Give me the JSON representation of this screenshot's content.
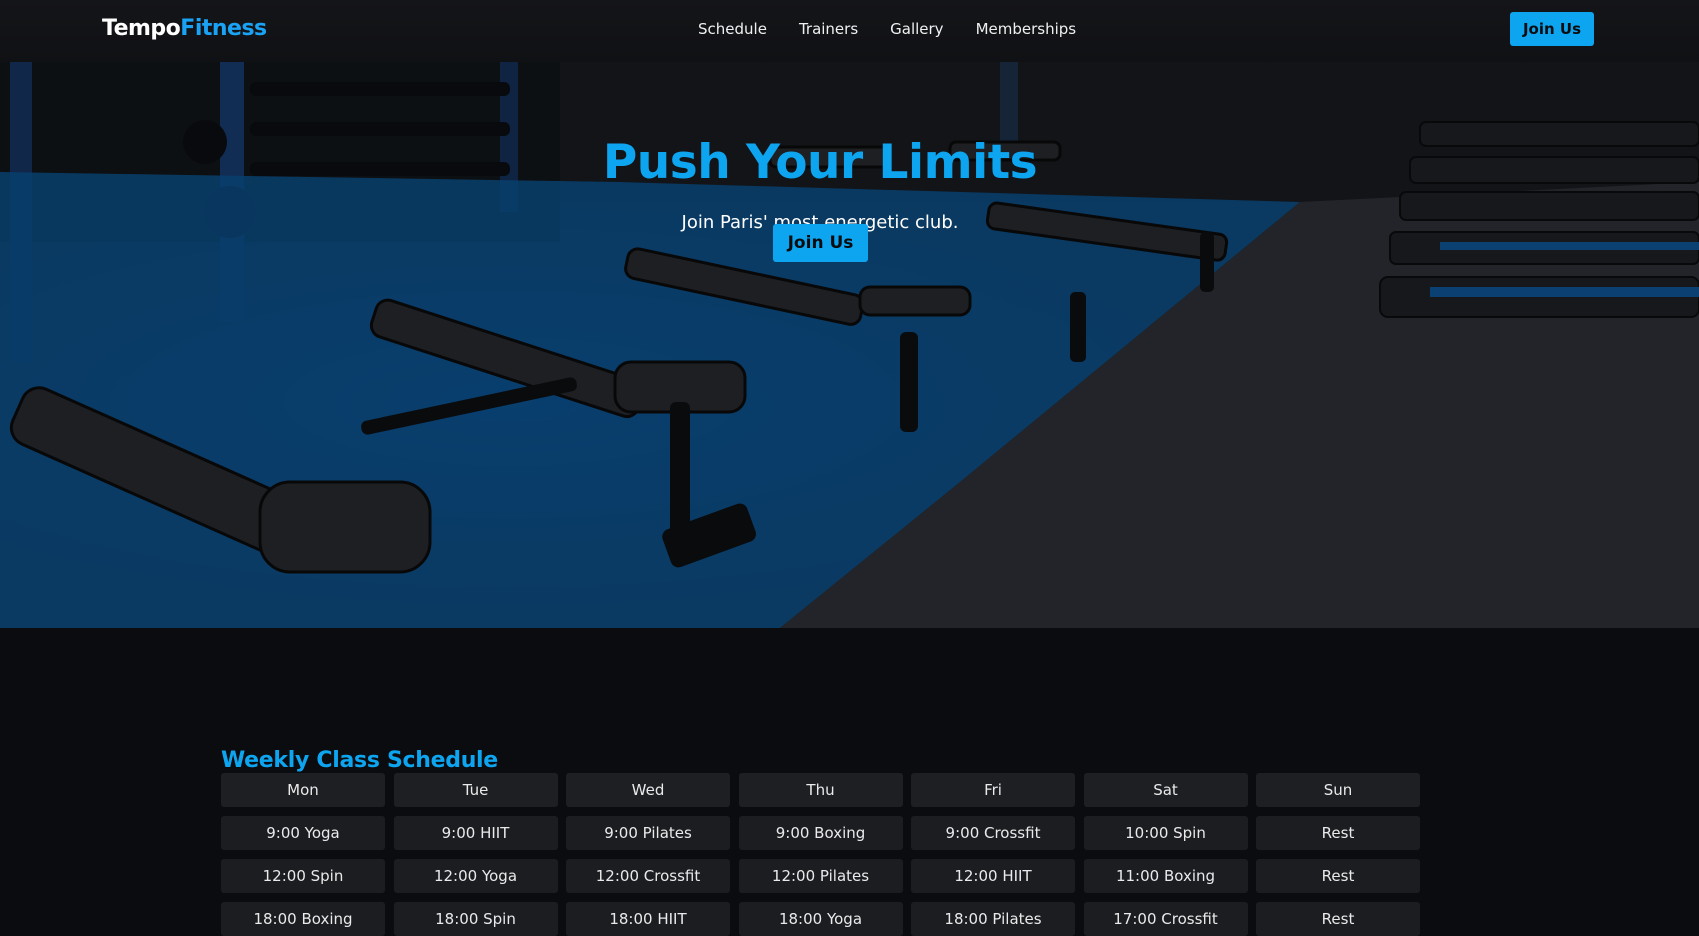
{
  "nav": {
    "logo_primary": "Tempo",
    "logo_accent": "Fitness",
    "links": [
      "Schedule",
      "Trainers",
      "Gallery",
      "Memberships"
    ],
    "cta": "Join Us"
  },
  "hero": {
    "title": "Push Your Limits",
    "subtitle": "Join Paris' most energetic club.",
    "cta": "Join Us"
  },
  "schedule": {
    "title": "Weekly Class Schedule",
    "days": [
      "Mon",
      "Tue",
      "Wed",
      "Thu",
      "Fri",
      "Sat",
      "Sun"
    ],
    "rows": [
      [
        "9:00 Yoga",
        "9:00 HIIT",
        "9:00 Pilates",
        "9:00 Boxing",
        "9:00 Crossfit",
        "10:00 Spin",
        "Rest"
      ],
      [
        "12:00 Spin",
        "12:00 Yoga",
        "12:00 Crossfit",
        "12:00 Pilates",
        "12:00 HIIT",
        "11:00 Boxing",
        "Rest"
      ],
      [
        "18:00 Boxing",
        "18:00 Spin",
        "18:00 HIIT",
        "18:00 Yoga",
        "18:00 Pilates",
        "17:00 Crossfit",
        "Rest"
      ]
    ]
  },
  "colors": {
    "accent": "#0ea5f0",
    "background": "#0b0c0f",
    "cell": "#1c1d21"
  }
}
